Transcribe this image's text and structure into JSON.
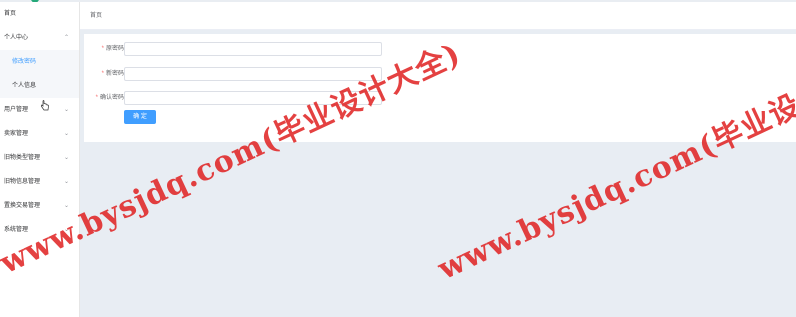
{
  "sidebar": {
    "items": [
      {
        "label": "首页",
        "has_arrow": false
      },
      {
        "label": "个人中心",
        "has_arrow": true,
        "expanded": true,
        "children": [
          {
            "label": "修改密码",
            "active": true
          },
          {
            "label": "个人信息",
            "active": false
          }
        ]
      },
      {
        "label": "用户管理",
        "has_arrow": true
      },
      {
        "label": "卖家管理",
        "has_arrow": true
      },
      {
        "label": "旧物类型管理",
        "has_arrow": true
      },
      {
        "label": "旧物信息管理",
        "has_arrow": true
      },
      {
        "label": "置换交易管理",
        "has_arrow": true
      },
      {
        "label": "系统管理",
        "has_arrow": true
      }
    ],
    "arrow_down_glyph": "⌄",
    "arrow_up_glyph": "⌃"
  },
  "breadcrumb": {
    "label": "首页"
  },
  "form": {
    "required_mark": "*",
    "old_password_label": "原密码",
    "new_password_label": "新密码",
    "confirm_password_label": "确认密码",
    "old_password_value": "",
    "new_password_value": "",
    "confirm_password_value": "",
    "submit_label": "确 定"
  },
  "watermark": {
    "text1": "www.bysjdq.com(毕业设计大全)",
    "text2": "www.bysjdq.com(毕业设计大"
  },
  "colors": {
    "accent": "#409eff",
    "active_text": "#409eff",
    "required": "#f56c6c",
    "content_bg": "#e8edf3",
    "watermark": "#e02020",
    "logo": "#25a879"
  }
}
